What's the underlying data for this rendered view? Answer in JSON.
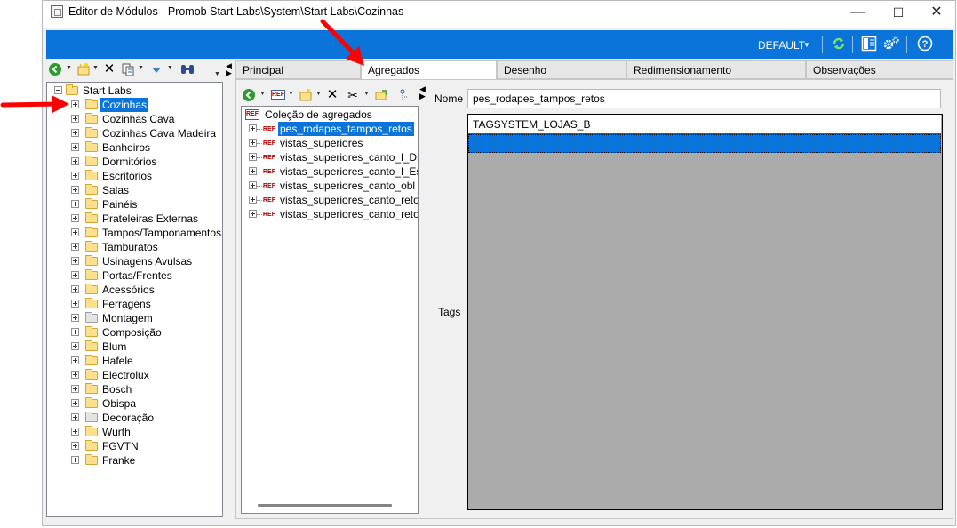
{
  "window": {
    "title": "Editor de Módulos - Promob Start Labs\\System\\Start Labs\\Cozinhas",
    "minimize_glyph": "—",
    "maximize_glyph": "☐",
    "close_glyph": "✕"
  },
  "ribbon": {
    "profile_label": "DEFAULT",
    "accent_color": "#0a74da"
  },
  "left_tree": {
    "root_label": "Start Labs",
    "selected_label": "Cozinhas",
    "items": [
      {
        "label": "Cozinhas",
        "selected": true
      },
      {
        "label": "Cozinhas Cava"
      },
      {
        "label": "Cozinhas Cava Madeira"
      },
      {
        "label": "Banheiros"
      },
      {
        "label": "Dormitórios"
      },
      {
        "label": "Escritórios"
      },
      {
        "label": "Salas"
      },
      {
        "label": "Painéis"
      },
      {
        "label": "Prateleiras Externas"
      },
      {
        "label": "Tampos/Tamponamentos"
      },
      {
        "label": "Tamburatos"
      },
      {
        "label": "Usinagens Avulsas"
      },
      {
        "label": "Portas/Frentes"
      },
      {
        "label": "Acessórios"
      },
      {
        "label": "Ferragens"
      },
      {
        "label": "Montagem",
        "grey": true
      },
      {
        "label": "Composição"
      },
      {
        "label": "Blum"
      },
      {
        "label": "Hafele"
      },
      {
        "label": "Electrolux"
      },
      {
        "label": "Bosch"
      },
      {
        "label": "Obispa"
      },
      {
        "label": "Decoração",
        "grey": true
      },
      {
        "label": "Wurth"
      },
      {
        "label": "FGVTN"
      },
      {
        "label": "Franke"
      }
    ]
  },
  "tabs": [
    {
      "label": "Principal"
    },
    {
      "label": "Agregados",
      "active": true
    },
    {
      "label": "Desenho"
    },
    {
      "label": "Redimensionamento"
    },
    {
      "label": "Observações"
    }
  ],
  "aggregates": {
    "root_label": "Coleção de agregados",
    "ref_glyph": "REF",
    "items": [
      {
        "label": "pes_rodapes_tampos_retos",
        "selected": true
      },
      {
        "label": "vistas_superiores"
      },
      {
        "label": "vistas_superiores_canto_l_Dir"
      },
      {
        "label": "vistas_superiores_canto_l_Esq"
      },
      {
        "label": "vistas_superiores_canto_obl"
      },
      {
        "label": "vistas_superiores_canto_reto_d"
      },
      {
        "label": "vistas_superiores_canto_reto_e"
      }
    ]
  },
  "form": {
    "nome_label": "Nome",
    "nome_value": "pes_rodapes_tampos_retos",
    "tags_label": "Tags",
    "tags": [
      "TAGSYSTEM_LOJAS_B",
      ""
    ]
  },
  "annotations": {
    "arrow_color": "#ff0000"
  }
}
